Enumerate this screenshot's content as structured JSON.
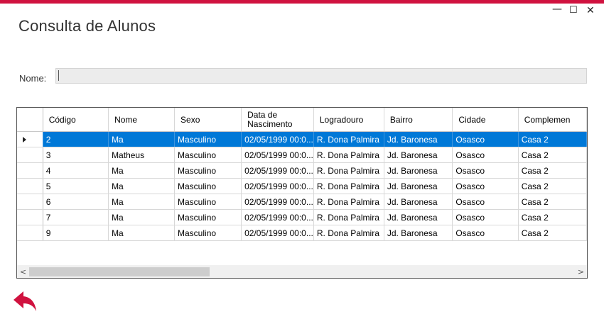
{
  "window": {
    "minimize_glyph": "—",
    "maximize_glyph": "☐",
    "close_glyph": "✕",
    "accent_color": "#d0123f"
  },
  "title": "Consulta de Alunos",
  "search": {
    "label": "Nome:",
    "value": ""
  },
  "grid": {
    "columns": [
      "Código",
      "Nome",
      "Sexo",
      "Data de Nascimento",
      "Logradouro",
      "Bairro",
      "Cidade",
      "Complemen"
    ],
    "selected_row_color": "#0078d7",
    "rows": [
      {
        "codigo": "2",
        "nome": "Ma",
        "sexo": "Masculino",
        "nascimento": "02/05/1999 00:0...",
        "logradouro": "R. Dona Palmira",
        "bairro": "Jd. Baronesa",
        "cidade": "Osasco",
        "complemento": "Casa 2"
      },
      {
        "codigo": "3",
        "nome": "Matheus",
        "sexo": "Masculino",
        "nascimento": "02/05/1999 00:0...",
        "logradouro": "R. Dona Palmira",
        "bairro": "Jd. Baronesa",
        "cidade": "Osasco",
        "complemento": "Casa 2"
      },
      {
        "codigo": "4",
        "nome": "Ma",
        "sexo": "Masculino",
        "nascimento": "02/05/1999 00:0...",
        "logradouro": "R. Dona Palmira",
        "bairro": "Jd. Baronesa",
        "cidade": "Osasco",
        "complemento": "Casa 2"
      },
      {
        "codigo": "5",
        "nome": "Ma",
        "sexo": "Masculino",
        "nascimento": "02/05/1999 00:0...",
        "logradouro": "R. Dona Palmira",
        "bairro": "Jd. Baronesa",
        "cidade": "Osasco",
        "complemento": "Casa 2"
      },
      {
        "codigo": "6",
        "nome": "Ma",
        "sexo": "Masculino",
        "nascimento": "02/05/1999 00:0...",
        "logradouro": "R. Dona Palmira",
        "bairro": "Jd. Baronesa",
        "cidade": "Osasco",
        "complemento": "Casa 2"
      },
      {
        "codigo": "7",
        "nome": "Ma",
        "sexo": "Masculino",
        "nascimento": "02/05/1999 00:0...",
        "logradouro": "R. Dona Palmira",
        "bairro": "Jd. Baronesa",
        "cidade": "Osasco",
        "complemento": "Casa 2"
      },
      {
        "codigo": "9",
        "nome": "Ma",
        "sexo": "Masculino",
        "nascimento": "02/05/1999 00:0...",
        "logradouro": "R. Dona Palmira",
        "bairro": "Jd. Baronesa",
        "cidade": "Osasco",
        "complemento": "Casa 2"
      }
    ],
    "scroll_left_glyph": "<",
    "scroll_right_glyph": ">"
  },
  "back_icon": "undo-arrow-icon"
}
